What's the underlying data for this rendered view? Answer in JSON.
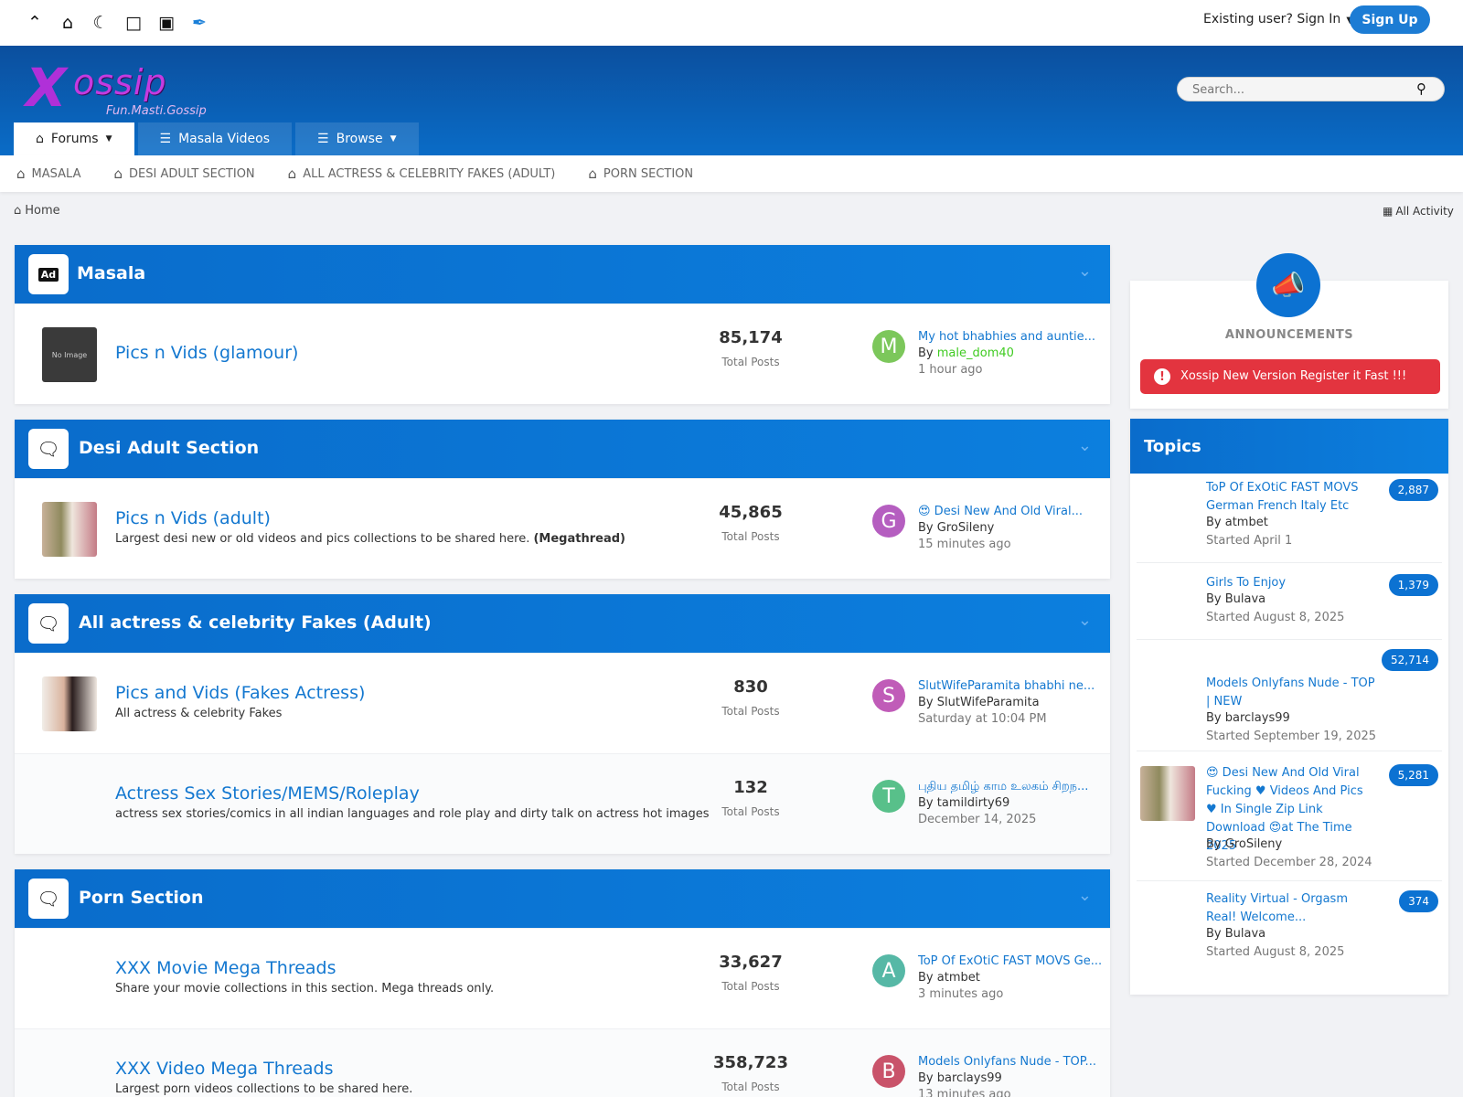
{
  "topbar": {
    "icons": [
      "chevron-up-icon",
      "home-icon",
      "moon-icon",
      "square-icon",
      "image-icon",
      "brush-icon"
    ],
    "signin_label": "Existing user? Sign In",
    "signup_label": "Sign Up"
  },
  "header": {
    "logo_main": "ossip",
    "logo_x": "X",
    "logo_tagline": "Fun.Masti.Gossip",
    "search_placeholder": "Search...",
    "tabs": [
      {
        "label": "Forums"
      },
      {
        "label": "Masala Videos"
      },
      {
        "label": "Browse"
      }
    ]
  },
  "subnav": {
    "items": [
      {
        "label": "Masala"
      },
      {
        "label": "Desi Adult Section"
      },
      {
        "label": "All actress & celebrity Fakes (Adult)"
      },
      {
        "label": "Porn Section"
      }
    ]
  },
  "breadcrumb": {
    "home": "Home",
    "all_activity": "All Activity"
  },
  "categories": [
    {
      "title": "Masala",
      "forums": [
        {
          "name": "Pics n Vids (glamour)",
          "desc": "",
          "count": "85,174",
          "count_label": "Total Posts",
          "avatar": "M",
          "last_title": "My hot bhabhies and auntie...",
          "by": "By",
          "user": "male_dom40",
          "time": "1 hour ago",
          "thumb_text": "No Image"
        }
      ]
    },
    {
      "title": "Desi Adult Section",
      "forums": [
        {
          "name": "Pics n Vids (adult)",
          "desc": "Largest desi new or old videos and pics collections to be shared here.",
          "desc_bold": "(Megathread)",
          "count": "45,865",
          "count_label": "Total Posts",
          "avatar": "G",
          "last_title": "😍 Desi New And Old Viral...",
          "by": "By",
          "user": "GroSileny",
          "time": "15 minutes ago"
        }
      ]
    },
    {
      "title": "All actress & celebrity Fakes (Adult)",
      "forums": [
        {
          "name": "Pics and Vids (Fakes Actress)",
          "desc": "All actress & celebrity Fakes",
          "count": "830",
          "count_label": "Total Posts",
          "avatar": "S",
          "last_title": "SlutWifeParamita bhabhi ne...",
          "by": "By",
          "user": "SlutWifeParamita",
          "time": "Saturday at 10:04 PM"
        },
        {
          "name": "Actress Sex Stories/MEMS/Roleplay",
          "desc": "actress sex stories/comics in all indian languages and role play and dirty talk on actress hot images",
          "count": "132",
          "count_label": "Total Posts",
          "avatar": "T",
          "last_title": "புதிய தமிழ் காம உலகம் சிறந...",
          "by": "By",
          "user": "tamildirty69",
          "time": "December 14, 2025"
        }
      ]
    },
    {
      "title": "Porn Section",
      "forums": [
        {
          "name": "XXX Movie Mega Threads",
          "desc": "Share your movie collections in this section. Mega threads only.",
          "count": "33,627",
          "count_label": "Total Posts",
          "avatar": "A",
          "last_title": "ToP Of ExOtiC FAST MOVS Ge...",
          "by": "By",
          "user": "atmbet",
          "time": "3 minutes ago"
        },
        {
          "name": "XXX Video Mega Threads",
          "desc": "Largest porn videos collections to be shared here.",
          "count": "358,723",
          "count_label": "Total Posts",
          "avatar": "B",
          "last_title": "Models Onlyfans Nude - TOP...",
          "by": "By",
          "user": "barclays99",
          "time": "13 minutes ago"
        }
      ]
    }
  ],
  "announcements": {
    "title": "ANNOUNCEMENTS",
    "alert": "Xossip New Version Register it Fast !!!"
  },
  "topics": {
    "title": "Topics",
    "items": [
      {
        "title": "ToP Of ExOtiC FAST MOVS German French Italy Etc",
        "by": "By atmbet",
        "started": "Started April 1",
        "count": "2,887"
      },
      {
        "title": "Girls To Enjoy",
        "by": "By Bulava",
        "started": "Started August 8, 2025",
        "count": "1,379"
      },
      {
        "title": "Models Onlyfans Nude - TOP | NEW",
        "by": "By barclays99",
        "started": "Started September 19, 2025",
        "count": "52,714"
      },
      {
        "title": "😍 Desi New And Old Viral Fucking ♥ Videos And Pics ♥ In Single Zip Link Download 😍at The Time 2025",
        "by": "By GroSileny",
        "started": "Started December 28, 2024",
        "count": "5,281"
      },
      {
        "title": "Reality Virtual - Orgasm Real! Welcome...",
        "by": "By Bulava",
        "started": "Started August 8, 2025",
        "count": "374"
      }
    ]
  },
  "colors": {
    "brand_blue": "#0c72d2",
    "alert_red": "#e3343f",
    "link_blue": "#1478d0"
  }
}
